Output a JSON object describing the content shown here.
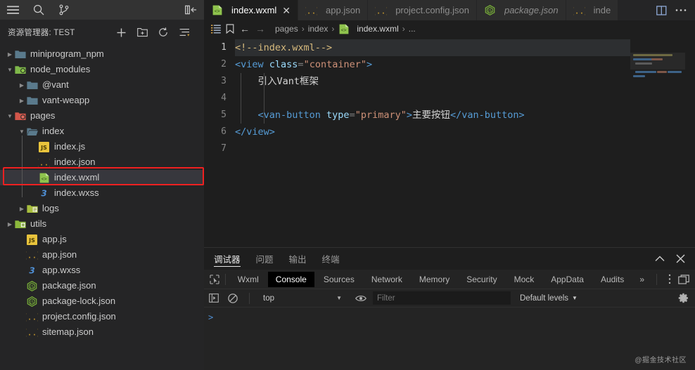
{
  "activity_bar": {
    "icons": [
      {
        "name": "menu-icon",
        "label": "菜单"
      },
      {
        "name": "search-icon",
        "label": "搜索"
      },
      {
        "name": "source-control-icon",
        "label": "源代码管理"
      }
    ],
    "collapse_sidebar_label": "折叠侧边栏"
  },
  "explorer": {
    "title": "资源管理器: TEST",
    "actions": [
      {
        "name": "new-file-icon",
        "label": "新建文件"
      },
      {
        "name": "new-folder-icon",
        "label": "新建文件夹"
      },
      {
        "name": "refresh-icon",
        "label": "刷新"
      },
      {
        "name": "collapse-all-icon",
        "label": "全部折叠"
      }
    ],
    "tree": [
      {
        "label": "miniprogram_npm",
        "type": "folder",
        "icon": "folder-icon",
        "depth": 1,
        "expanded": false,
        "selected": false
      },
      {
        "label": "node_modules",
        "type": "folder",
        "icon": "folder-node-icon",
        "depth": 1,
        "expanded": true,
        "selected": false
      },
      {
        "label": "@vant",
        "type": "folder",
        "icon": "folder-icon",
        "depth": 2,
        "expanded": false,
        "selected": false
      },
      {
        "label": "vant-weapp",
        "type": "folder",
        "icon": "folder-icon",
        "depth": 2,
        "expanded": false,
        "selected": false
      },
      {
        "label": "pages",
        "type": "folder",
        "icon": "folder-pages-icon",
        "depth": 1,
        "expanded": true,
        "selected": false
      },
      {
        "label": "index",
        "type": "folder",
        "icon": "folder-open-icon",
        "depth": 2,
        "expanded": true,
        "selected": false
      },
      {
        "label": "index.js",
        "type": "file",
        "icon": "js-file-icon",
        "depth": 3,
        "selected": false
      },
      {
        "label": "index.json",
        "type": "file",
        "icon": "json-file-icon",
        "depth": 3,
        "selected": false
      },
      {
        "label": "index.wxml",
        "type": "file",
        "icon": "wxml-file-icon",
        "depth": 3,
        "selected": true
      },
      {
        "label": "index.wxss",
        "type": "file",
        "icon": "css-file-icon",
        "depth": 3,
        "selected": false
      },
      {
        "label": "logs",
        "type": "folder",
        "icon": "folder-logs-icon",
        "depth": 2,
        "expanded": false,
        "selected": false
      },
      {
        "label": "utils",
        "type": "folder",
        "icon": "folder-utils-icon",
        "depth": 1,
        "expanded": false,
        "selected": false
      },
      {
        "label": "app.js",
        "type": "file",
        "icon": "js-file-icon",
        "depth": 2,
        "selected": false
      },
      {
        "label": "app.json",
        "type": "file",
        "icon": "json-file-icon",
        "depth": 2,
        "selected": false
      },
      {
        "label": "app.wxss",
        "type": "file",
        "icon": "css-file-icon",
        "depth": 2,
        "selected": false
      },
      {
        "label": "package.json",
        "type": "file",
        "icon": "npm-file-icon",
        "depth": 2,
        "selected": false
      },
      {
        "label": "package-lock.json",
        "type": "file",
        "icon": "npm-file-icon",
        "depth": 2,
        "selected": false
      },
      {
        "label": "project.config.json",
        "type": "file",
        "icon": "json-file-icon",
        "depth": 2,
        "selected": false
      },
      {
        "label": "sitemap.json",
        "type": "file",
        "icon": "json-file-icon",
        "depth": 2,
        "selected": false
      }
    ]
  },
  "tabs": {
    "items": [
      {
        "label": "index.wxml",
        "icon": "wxml-file-icon",
        "active": true,
        "preview": false,
        "closable": true
      },
      {
        "label": "app.json",
        "icon": "json-file-icon",
        "active": false,
        "preview": false,
        "closable": false
      },
      {
        "label": "project.config.json",
        "icon": "json-file-icon",
        "active": false,
        "preview": false,
        "closable": false
      },
      {
        "label": "package.json",
        "icon": "npm-file-icon",
        "active": false,
        "preview": true,
        "closable": false
      },
      {
        "label": "inde",
        "icon": "json-file-icon",
        "active": false,
        "preview": false,
        "closable": false
      }
    ],
    "actions": [
      {
        "name": "split-editor-icon",
        "label": "拆分编辑器"
      },
      {
        "name": "more-actions-icon",
        "label": "更多操作"
      }
    ]
  },
  "breadcrumbs": {
    "tools": [
      {
        "name": "outline-icon",
        "label": "大纲"
      },
      {
        "name": "bookmark-icon",
        "label": "书签"
      }
    ],
    "nav_back": "←",
    "nav_forward": "→",
    "items": [
      "pages",
      "index",
      "index.wxml",
      "..."
    ],
    "separator": "›",
    "file_icon": "wxml-file-icon"
  },
  "editor": {
    "language": "wxml",
    "lines": [
      {
        "num": 1,
        "folded": false,
        "active": true,
        "tokens": [
          {
            "t": "<!--index.wxml-->",
            "c": "cmt-y"
          }
        ]
      },
      {
        "num": 2,
        "folded": true,
        "active": false,
        "tokens": [
          {
            "t": "<view ",
            "c": "tag"
          },
          {
            "t": "class",
            "c": "attr"
          },
          {
            "t": "=",
            "c": "punc"
          },
          {
            "t": "\"container\"",
            "c": "str"
          },
          {
            "t": ">",
            "c": "tag"
          }
        ]
      },
      {
        "num": 3,
        "folded": false,
        "active": false,
        "indent": 2,
        "tokens": [
          {
            "t": "    引入Vant框架",
            "c": "txt"
          }
        ]
      },
      {
        "num": 4,
        "folded": false,
        "active": false,
        "indent": 2,
        "tokens": [
          {
            "t": "",
            "c": "txt"
          }
        ]
      },
      {
        "num": 5,
        "folded": false,
        "active": false,
        "indent": 2,
        "tokens": [
          {
            "t": "    <van-button ",
            "c": "tag"
          },
          {
            "t": "type",
            "c": "attr"
          },
          {
            "t": "=",
            "c": "punc"
          },
          {
            "t": "\"primary\"",
            "c": "str"
          },
          {
            "t": ">",
            "c": "tag"
          },
          {
            "t": "主要按钮",
            "c": "txt"
          },
          {
            "t": "</van-button>",
            "c": "tag"
          }
        ]
      },
      {
        "num": 6,
        "folded": false,
        "active": false,
        "tokens": [
          {
            "t": "</view>",
            "c": "tag"
          }
        ]
      },
      {
        "num": 7,
        "folded": false,
        "active": false,
        "tokens": [
          {
            "t": "",
            "c": "txt"
          }
        ]
      }
    ]
  },
  "panel": {
    "tabs": [
      {
        "label": "调试器",
        "active": true
      },
      {
        "label": "问题",
        "active": false
      },
      {
        "label": "输出",
        "active": false
      },
      {
        "label": "终端",
        "active": false
      }
    ],
    "actions": [
      {
        "name": "chevron-up-icon",
        "label": "最大化面板"
      },
      {
        "name": "close-icon",
        "label": "关闭面板"
      }
    ]
  },
  "devtools": {
    "inspect_icon": "inspect-element-icon",
    "tabs": [
      {
        "label": "Wxml",
        "active": false
      },
      {
        "label": "Console",
        "active": true
      },
      {
        "label": "Sources",
        "active": false
      },
      {
        "label": "Network",
        "active": false
      },
      {
        "label": "Memory",
        "active": false
      },
      {
        "label": "Security",
        "active": false
      },
      {
        "label": "Mock",
        "active": false
      },
      {
        "label": "AppData",
        "active": false
      },
      {
        "label": "Audits",
        "active": false
      }
    ],
    "overflow_label": "»",
    "right_icons": [
      {
        "name": "more-vertical-icon",
        "label": "更多"
      },
      {
        "name": "dock-side-icon",
        "label": "停靠位置"
      }
    ],
    "filter_bar": {
      "sidebar_toggle_icon": "console-sidebar-icon",
      "clear_icon": "clear-console-icon",
      "context": "top",
      "context_caret": "▼",
      "eye_icon": "live-expression-icon",
      "filter_placeholder": "Filter",
      "filter_value": "",
      "levels_label": "Default levels",
      "levels_caret": "▼",
      "settings_icon": "gear-icon"
    },
    "console_prompt": ">"
  },
  "watermark": "@掘金技术社区",
  "colors": {
    "accent_blue": "#569cd6",
    "string_orange": "#ce9178",
    "comment_yellow": "#d7ba7d",
    "annotation_red": "#f02020",
    "sidebar_bg": "#252526",
    "editor_bg": "#1e1e1e"
  }
}
